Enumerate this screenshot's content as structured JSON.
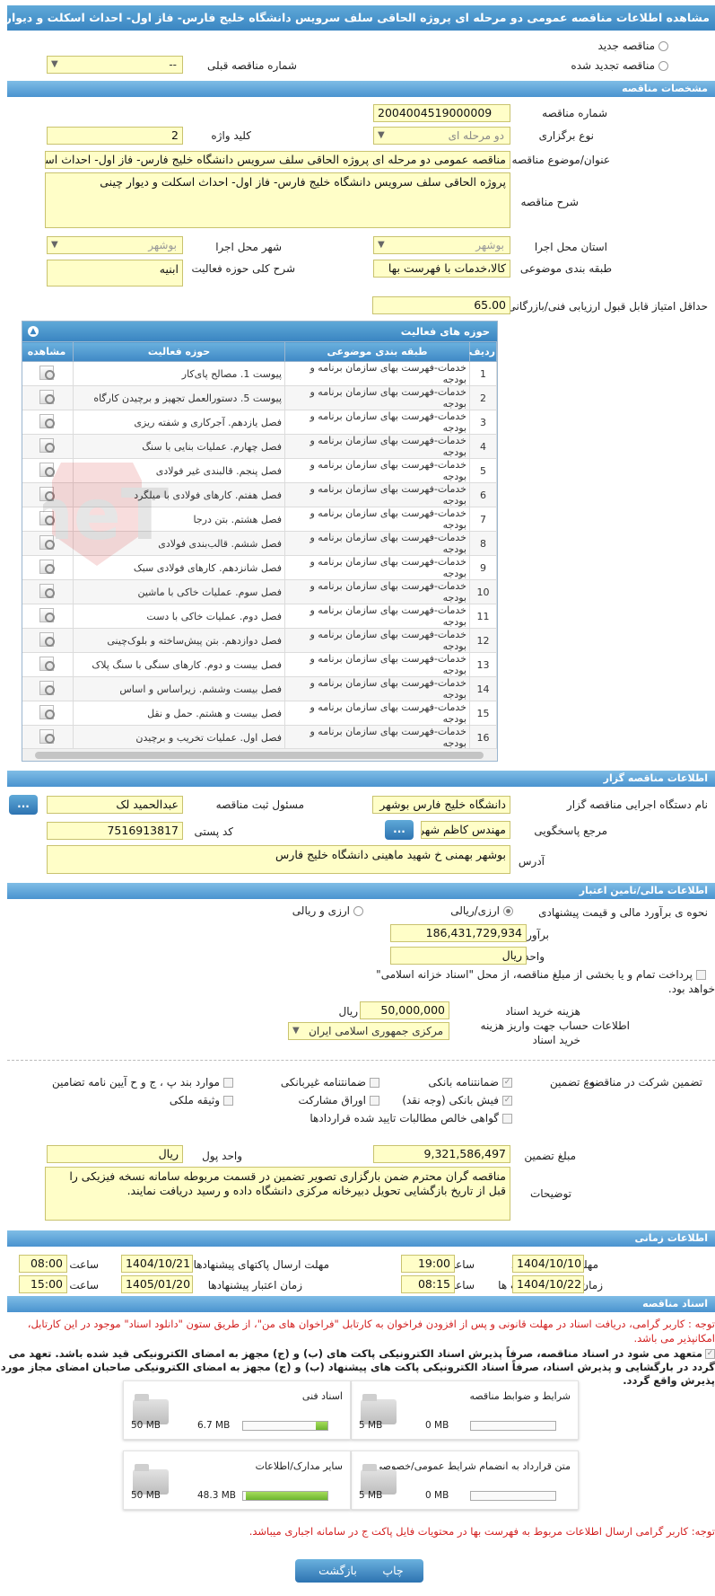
{
  "header": {
    "title": "مشاهده اطلاعات مناقصه عمومی دو مرحله ای پروژه الحاقی سلف سرویس دانشگاه خلیج فارس- فاز اول- احداث اسکلت و دیوار چینی"
  },
  "tender_type_options": {
    "new": "مناقصه جدید",
    "renewed": "مناقصه تجدید شده",
    "prev_number_label": "شماره مناقصه قبلی",
    "prev_number_value": "--"
  },
  "sections": {
    "specs": "مشخصات مناقصه",
    "activities": "حوزه های فعالیت",
    "organizer": "اطلاعات مناقصه گزار",
    "financial": "اطلاعات مالی/تامین اعتبار",
    "timing": "اطلاعات زمانی",
    "documents": "اسناد مناقصه"
  },
  "specs": {
    "number_label": "شماره مناقصه",
    "number": "2004004519000009",
    "type_label": "نوع برگزاری",
    "type": "دو مرحله ای",
    "keyword_label": "کلید واژه",
    "keyword": "2",
    "subject_label": "عنوان/موضوع مناقصه",
    "subject": "مناقصه عمومی دو مرحله ای پروژه الحاقی سلف سرویس دانشگاه خلیج فارس- فاز اول- احداث اسکلت و دیوار چینی",
    "desc_label": "شرح مناقصه",
    "desc": "پروژه الحاقی سلف سرویس دانشگاه خلیج فارس- فاز اول- احداث اسکلت و دیوار چینی",
    "province_label": "استان محل اجرا",
    "province": "بوشهر",
    "city_label": "شهر محل اجرا",
    "city": "بوشهر",
    "category_label": "طبقه بندی موضوعی",
    "category": "کالا،خدمات با فهرست بها",
    "activity_desc_label": "شرح کلی حوزه فعالیت",
    "activity_desc": "ابنیه",
    "min_score_label": "حداقل امتیاز قابل قبول ارزیابی فنی/بازرگانی",
    "min_score": "65.00"
  },
  "activities": {
    "columns": {
      "row": "ردیف",
      "category": "طبقه بندی موضوعی",
      "field": "حوزه فعالیت",
      "view": "مشاهده"
    },
    "rows": [
      {
        "n": "1",
        "category": "خدمات-فهرست بهای سازمان برنامه و بودجه",
        "field": "پیوست 1. مصالح پای‌کار"
      },
      {
        "n": "2",
        "category": "خدمات-فهرست بهای سازمان برنامه و بودجه",
        "field": "پیوست 5. دستورالعمل تجهیز و برچیدن کارگاه"
      },
      {
        "n": "3",
        "category": "خدمات-فهرست بهای سازمان برنامه و بودجه",
        "field": "فصل یازدهم. آجرکاری و شفته ریزی"
      },
      {
        "n": "4",
        "category": "خدمات-فهرست بهای سازمان برنامه و بودجه",
        "field": "فصل چهارم. عملیات بنایی با سنگ"
      },
      {
        "n": "5",
        "category": "خدمات-فهرست بهای سازمان برنامه و بودجه",
        "field": "فصل پنجم. قالبندی غیر فولادی"
      },
      {
        "n": "6",
        "category": "خدمات-فهرست بهای سازمان برنامه و بودجه",
        "field": "فصل هفتم. کارهای فولادی با میلگرد"
      },
      {
        "n": "7",
        "category": "خدمات-فهرست بهای سازمان برنامه و بودجه",
        "field": "فصل هشتم. بتن درجا"
      },
      {
        "n": "8",
        "category": "خدمات-فهرست بهای سازمان برنامه و بودجه",
        "field": "فصل ششم. قالب‌بندی فولادی"
      },
      {
        "n": "9",
        "category": "خدمات-فهرست بهای سازمان برنامه و بودجه",
        "field": "فصل شانزدهم. کارهای فولادی سبک"
      },
      {
        "n": "10",
        "category": "خدمات-فهرست بهای سازمان برنامه و بودجه",
        "field": "فصل سوم. عملیات خاکی با ماشین"
      },
      {
        "n": "11",
        "category": "خدمات-فهرست بهای سازمان برنامه و بودجه",
        "field": "فصل دوم. عملیات خاکی با دست"
      },
      {
        "n": "12",
        "category": "خدمات-فهرست بهای سازمان برنامه و بودجه",
        "field": "فصل دوازدهم. بتن پیش‌ساخته و بلوک‌چینی"
      },
      {
        "n": "13",
        "category": "خدمات-فهرست بهای سازمان برنامه و بودجه",
        "field": "فصل بیست و دوم. کارهای سنگی با سنگ پلاک"
      },
      {
        "n": "14",
        "category": "خدمات-فهرست بهای سازمان برنامه و بودجه",
        "field": "فصل بیست وششم. زیراساس و اساس"
      },
      {
        "n": "15",
        "category": "خدمات-فهرست بهای سازمان برنامه و بودجه",
        "field": "فصل بیست و هشتم. حمل و نقل"
      },
      {
        "n": "16",
        "category": "خدمات-فهرست بهای سازمان برنامه و بودجه",
        "field": "فصل اول. عملیات تخریب و برچیدن"
      }
    ]
  },
  "organizer": {
    "org_label": "نام دستگاه اجرایی مناقصه گزار",
    "org": "دانشگاه خلیج فارس بوشهر",
    "registrar_label": "مسئول ثبت مناقصه",
    "registrar": "عبدالحمید لک",
    "ref_label": "مرجع پاسخگویی",
    "ref": "مهندس کاظم شهریاری",
    "postal_label": "کد پستی",
    "postal": "7516913817",
    "address_label": "آدرس",
    "address": "بوشهر بهمنی خ شهید ماهینی دانشگاه خلیج فارس",
    "dots": "..."
  },
  "financial": {
    "estimate_method_label": "نحوه ی برآورد مالی و قیمت پیشنهادی",
    "opt_rial": "ارزی/ریالی",
    "opt_fx_rial": "ارزی و ریالی",
    "estimate_label": "برآورد مالی",
    "estimate": "186,431,729,934",
    "currency_label": "واحد پول",
    "currency": "ریال",
    "treasury_note": "پرداخت تمام و یا بخشی از مبلغ مناقصه، از محل \"اسناد خزانه اسلامی\"",
    "treasury_note2": "خواهد بود.",
    "doc_cost_label": "هزینه خرید اسناد",
    "doc_cost": "50,000,000",
    "doc_cost_unit": "ریال",
    "account_label": "اطلاعات حساب جهت واریز هزینه",
    "account_label2": "خرید اسناد",
    "account": "مرکزی جمهوری اسلامی ایران",
    "guarantee_title": "تضمین شرکت در مناقصه:",
    "guarantee_type_label": "نوع تضمین",
    "g_bank": "ضمانتنامه بانکی",
    "g_nonbank": "ضمانتنامه غیربانکی",
    "g_clauses": "موارد بند پ ، ج و ح آیین نامه تضامین",
    "g_check": "فیش بانکی (وجه نقد)",
    "g_bonds": "اوراق مشارکت",
    "g_property": "وثیقه ملکی",
    "g_claims": "گواهی خالص مطالبات تایید شده قراردادها",
    "amount_label": "مبلغ تضمین",
    "amount": "9,321,586,497",
    "amount_currency_label": "واحد پول",
    "amount_currency": "ریال",
    "notes_label": "توضیحات",
    "notes": "مناقصه گران محترم ضمن بارگزاری تصویر تضمین در قسمت مربوطه سامانه نسخه فیزیکی را قبل از تاریخ بازگشایی تحویل دبیرخانه مرکزی دانشگاه داده و رسید دریافت نمایند."
  },
  "timing": {
    "doc_deadline_label": "مهلت دریافت اسناد",
    "doc_deadline_date": "1404/10/10",
    "doc_deadline_time": "19:00",
    "submit_deadline_label": "مهلت ارسال پاکتهای پیشنهادها",
    "submit_deadline_date": "1404/10/21",
    "submit_deadline_time": "08:00",
    "opening_label": "زمان بازگشایی پاکت ها",
    "opening_date": "1404/10/22",
    "opening_time": "08:15",
    "validity_label": "زمان اعتبار پیشنهادها",
    "validity_date": "1405/01/20",
    "validity_time": "15:00",
    "time_label": "ساعت"
  },
  "documents": {
    "notice1": "توجه : کاربر گرامی، دریافت اسناد در مهلت قانونی و پس از افزودن فراخوان به کارتابل \"فراخوان های من\"، از طریق ستون \"دانلود اسناد\" موجود در این کارتابل، امکانپذیر می باشد.",
    "notice2": "متعهد می شود در اسناد مناقصه، صرفاً پذیرش اسناد الکترونیکی پاکت های (ب) و (ج) مجهز به امضای الکترونیکی قید شده باشد. تعهد می گردد در بارگشایی و پذیرش اسناد، صرفاً اسناد الکترونیکی پاکت های پیشنهاد (ب) و (ج) مجهز به امضای الکترونیکی صاحبان امضای مجاز مورد پذیرش واقع گردد.",
    "cards": [
      {
        "title": "شرایط و ضوابط مناقصه",
        "used": "0 MB",
        "max": "5 MB",
        "fill": 0
      },
      {
        "title": "اسناد فنی",
        "used": "6.7 MB",
        "max": "50 MB",
        "fill": 0.134
      },
      {
        "title": "متن قرارداد به انضمام شرایط عمومی/خصوصی",
        "used": "0 MB",
        "max": "5 MB",
        "fill": 0
      },
      {
        "title": "سایر مدارک/اطلاعات",
        "used": "48.3 MB",
        "max": "50 MB",
        "fill": 0.966
      }
    ],
    "notice3": "توجه: کاربر گرامی ارسال اطلاعات مربوط به فهرست بها در محتویات فایل پاکت ج در سامانه اجباری میباشد."
  },
  "footer": {
    "print": "چاپ",
    "back": "بازگشت"
  },
  "watermark": "AriaTender.neT"
}
